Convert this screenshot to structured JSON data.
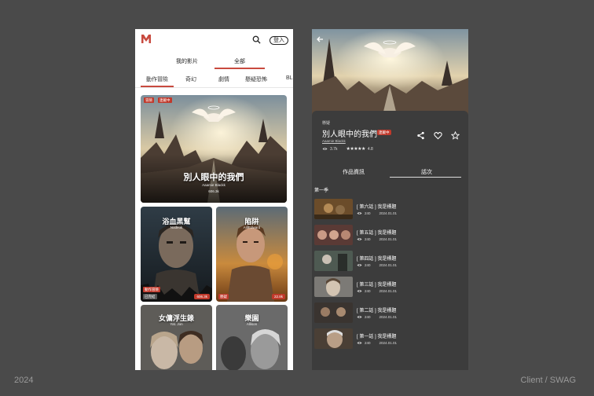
{
  "footer": {
    "year": "2024",
    "client": "Client / SWAG"
  },
  "left_phone": {
    "logo_letter": "M",
    "login_label": "登入",
    "main_tabs": [
      "我的影片",
      "全部"
    ],
    "genre_tabs": [
      "動作冒險",
      "奇幻",
      "劇情",
      "懸疑恐怖",
      "BL"
    ],
    "featured": {
      "badges": [
        "冒險",
        "連載中"
      ],
      "title": "別人眼中的我們",
      "author": "Aaamie Blackk",
      "views": "606.3k"
    },
    "cards": [
      {
        "title": "浴血黑幫",
        "author": "Nodeok",
        "badges": [
          "動作冒險",
          "已完結"
        ],
        "views": "606.3k"
      },
      {
        "title": "陷阱",
        "author": "AlifEdward",
        "badges": [
          "懸疑"
        ],
        "views": "22.8k"
      },
      {
        "title": "女傭浮生錄",
        "author": "Yat. Jon",
        "badges": [],
        "views": ""
      },
      {
        "title": "樂園",
        "author": "Allison",
        "badges": [],
        "views": ""
      }
    ],
    "colors": {
      "accent": "#c84a3f"
    }
  },
  "right_phone": {
    "genre": "懸疑",
    "title": "別人眼中的我們",
    "status_badge": "連載中",
    "author": "Aaamie Blackk",
    "views": "3.7k",
    "rating": "4.8",
    "tabs": [
      "作品資訊",
      "話次"
    ],
    "season": "第一季",
    "episodes": [
      {
        "title": "[ 第六話 ] 我是標題",
        "views": "240",
        "date": "2024.01.01"
      },
      {
        "title": "[ 第五話 ] 我是標題",
        "views": "240",
        "date": "2024.01.01"
      },
      {
        "title": "[ 第四話 ] 我是標題",
        "views": "240",
        "date": "2024.01.01"
      },
      {
        "title": "[ 第三話 ] 我是標題",
        "views": "240",
        "date": "2024.01.01"
      },
      {
        "title": "[ 第二話 ] 我是標題",
        "views": "240",
        "date": "2024.01.01"
      },
      {
        "title": "[ 第一話 ] 我是標題",
        "views": "240",
        "date": "2024.01.01"
      }
    ],
    "icons": [
      "back-arrow-icon",
      "share-icon",
      "heart-icon",
      "star-icon",
      "eye-icon"
    ]
  }
}
